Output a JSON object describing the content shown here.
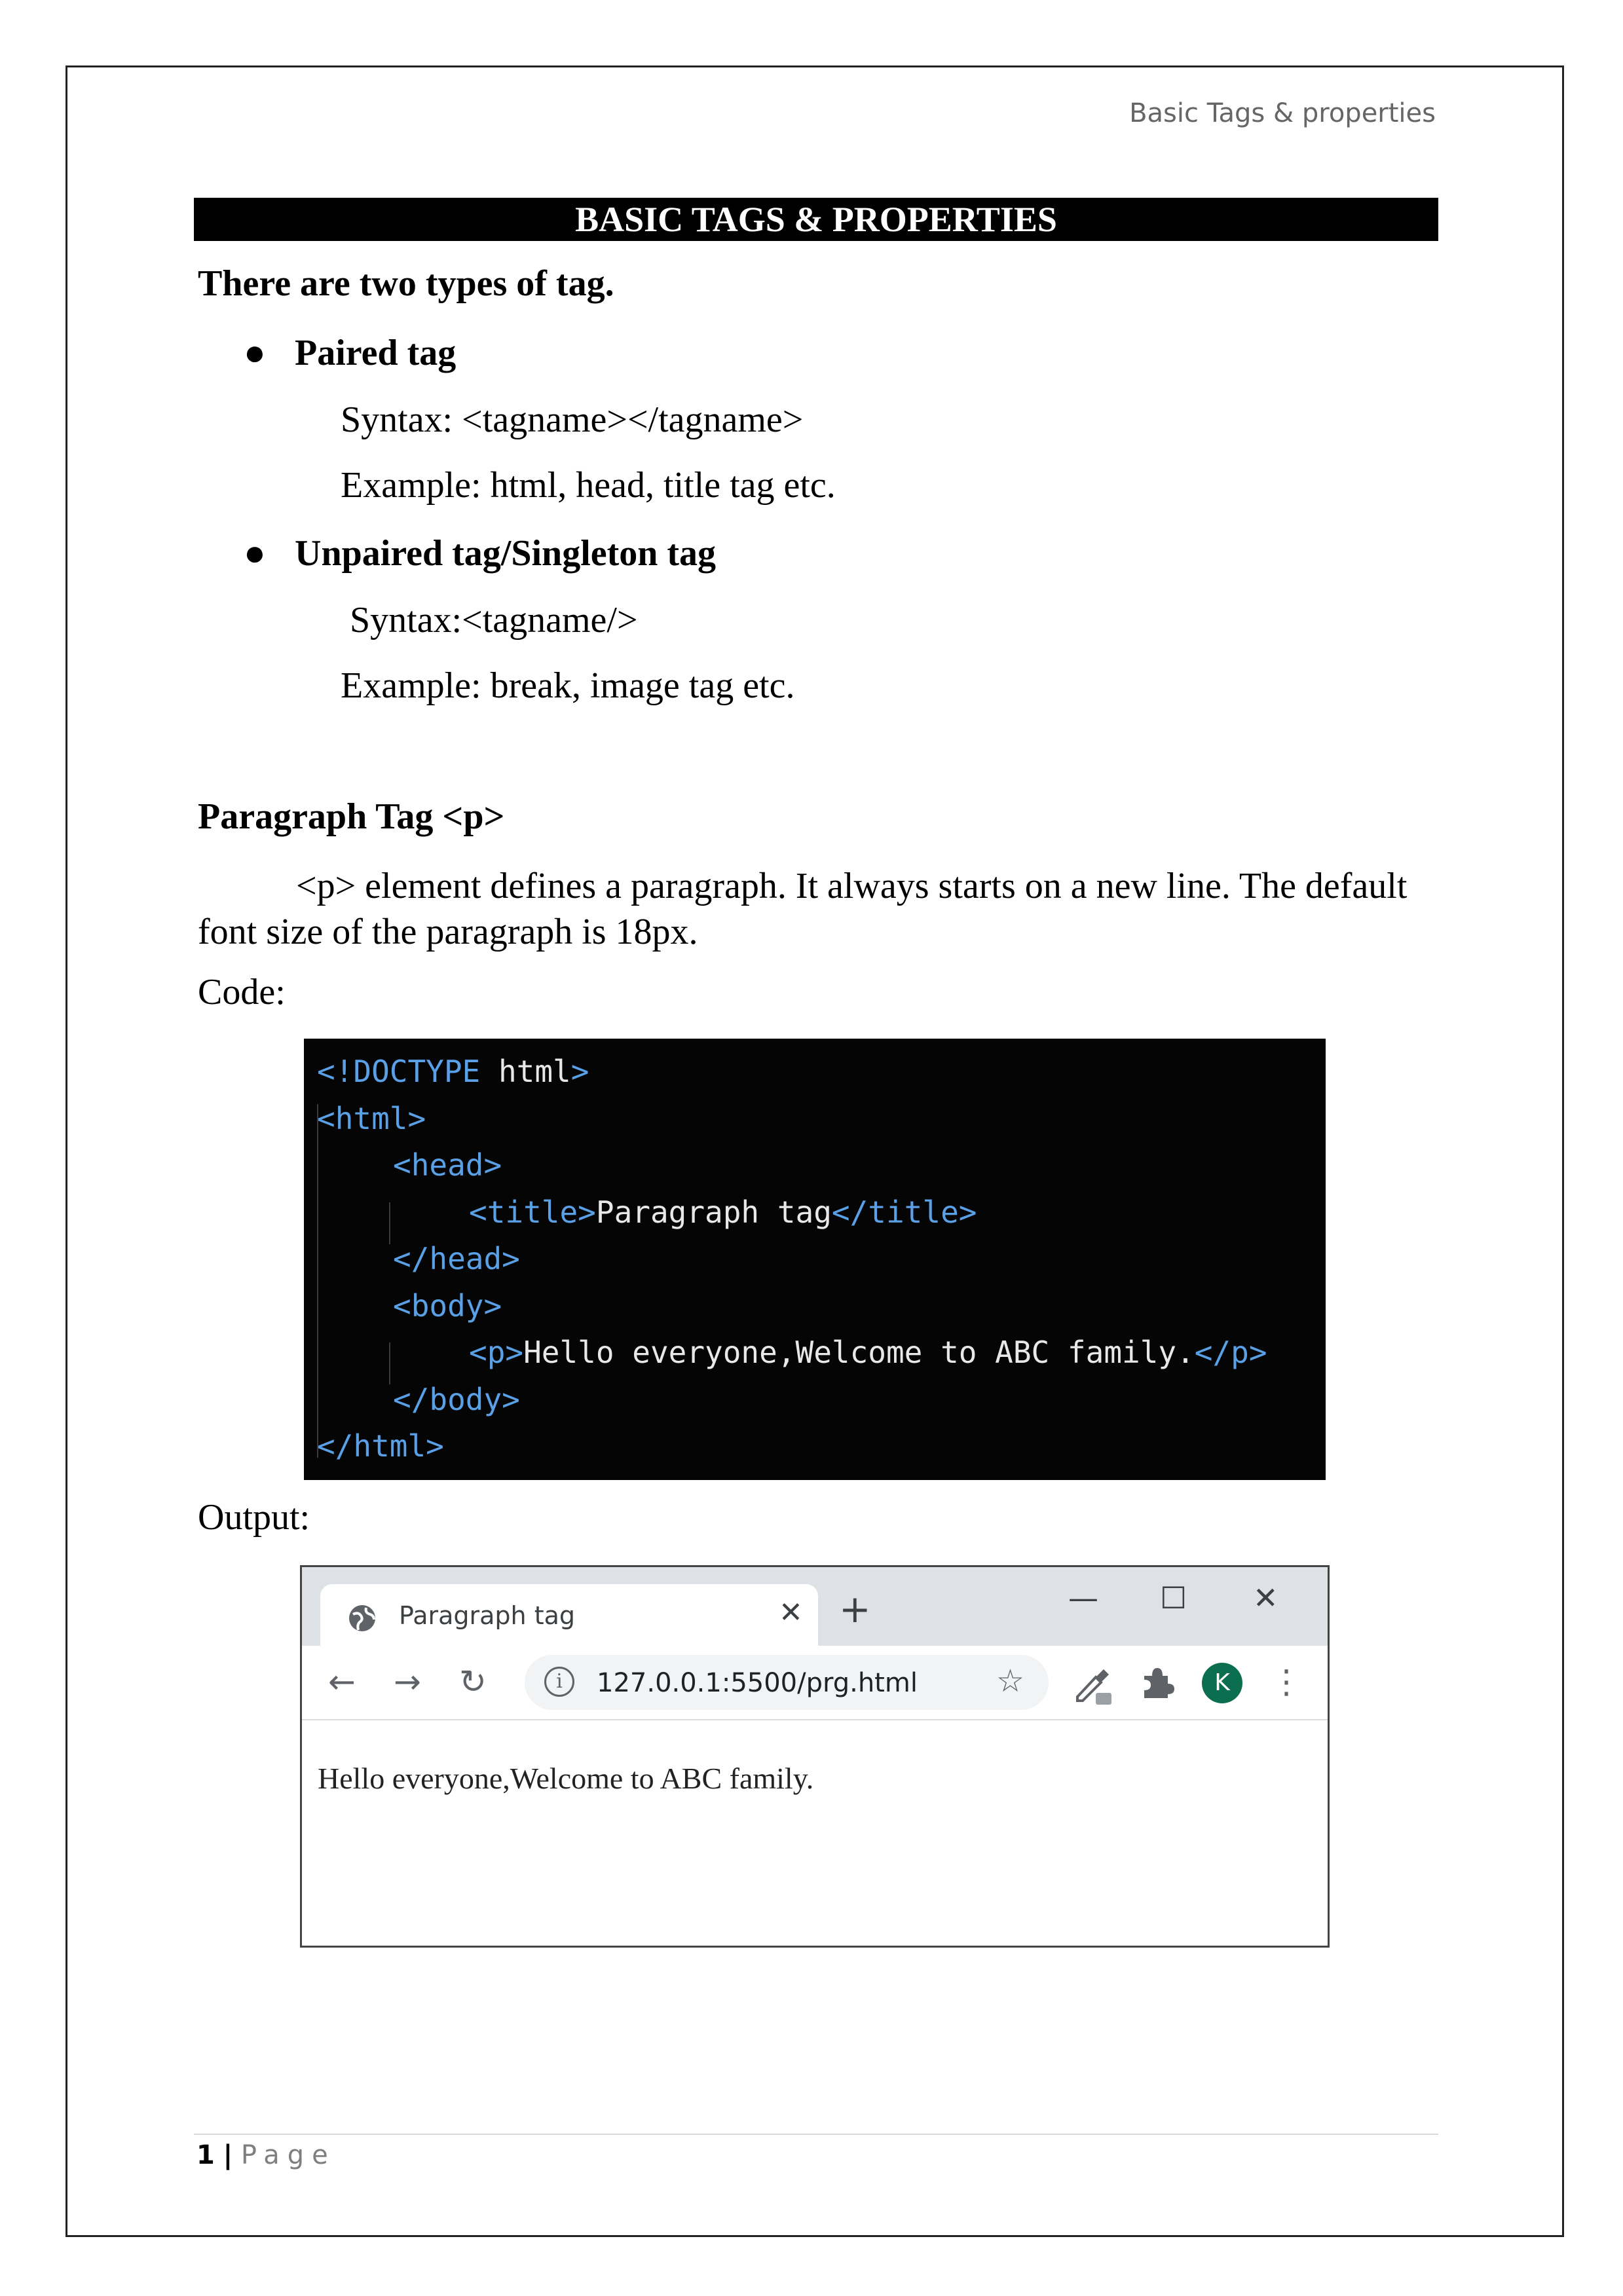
{
  "header": {
    "running_title": "Basic Tags & properties"
  },
  "title": "BASIC TAGS & PROPERTIES",
  "intro": "There are two types of tag.",
  "tag_types": [
    {
      "name": "Paired tag",
      "syntax": "Syntax: <tagname></tagname>",
      "example": "Example: html, head, title tag etc."
    },
    {
      "name": "Unpaired tag/Singleton tag",
      "syntax": "Syntax:<tagname/>",
      "example": "Example: break, image tag etc."
    }
  ],
  "section": {
    "heading": "Paragraph Tag <p>",
    "paragraph": "<p> element defines a paragraph. It always starts on a new line. The default font size of the paragraph is 18px.",
    "code_label": "Code:",
    "output_label": "Output:"
  },
  "code": {
    "lines": [
      {
        "parts": [
          [
            "tag",
            "<!DOCTYPE "
          ],
          [
            "kw",
            "html"
          ],
          [
            "tag",
            ">"
          ]
        ]
      },
      {
        "parts": [
          [
            "tag",
            "<html>"
          ]
        ]
      },
      {
        "parts": [
          [
            "tag",
            "<head>"
          ]
        ]
      },
      {
        "parts": [
          [
            "tag",
            "<title>"
          ],
          [
            "txt",
            "Paragraph tag"
          ],
          [
            "tag",
            "</title>"
          ]
        ]
      },
      {
        "parts": [
          [
            "tag",
            "</head>"
          ]
        ]
      },
      {
        "parts": [
          [
            "tag",
            "<body>"
          ]
        ]
      },
      {
        "parts": [
          [
            "tag",
            "<p>"
          ],
          [
            "txt",
            "Hello everyone,Welcome to ABC family."
          ],
          [
            "tag",
            "</p>"
          ]
        ]
      },
      {
        "parts": [
          [
            "tag",
            "</body>"
          ]
        ]
      },
      {
        "parts": [
          [
            "tag",
            "</html>"
          ]
        ]
      }
    ]
  },
  "browser": {
    "tab_title": "Paragraph tag",
    "tab_close": "✕",
    "new_tab": "+",
    "minimize": "—",
    "maximize": "☐",
    "close": "✕",
    "back": "←",
    "forward": "→",
    "reload": "↻",
    "info": "i",
    "url": "127.0.0.1:5500/prg.html",
    "star": "☆",
    "avatar_letter": "K",
    "menu": "⋮",
    "page_text": "Hello everyone,Welcome to ABC family."
  },
  "footer": {
    "page_number": "1",
    "separator": "|",
    "page_label": "Page"
  }
}
